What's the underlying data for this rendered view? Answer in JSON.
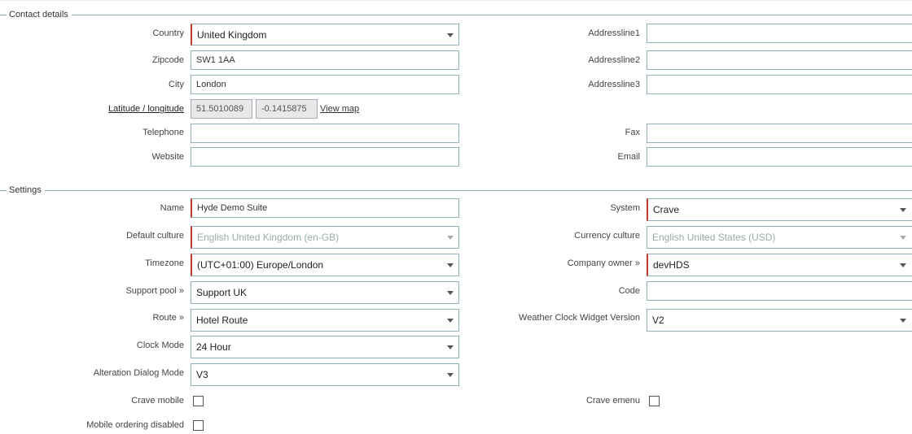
{
  "contact": {
    "legend": "Contact details",
    "country_label": "Country",
    "country_value": "United Kingdom",
    "zipcode_label": "Zipcode",
    "zipcode_value": "SW1 1AA",
    "city_label": "City",
    "city_value": "London",
    "latlng_label": "Latitude / longitude",
    "latitude": "51.5010089",
    "longitude": "-0.1415875",
    "view_map": "View map",
    "telephone_label": "Telephone",
    "telephone_value": "",
    "website_label": "Website",
    "website_value": "",
    "address1_label": "Addressline1",
    "address1_value": "",
    "address2_label": "Addressline2",
    "address2_value": "",
    "address3_label": "Addressline3",
    "address3_value": "",
    "fax_label": "Fax",
    "fax_value": "",
    "email_label": "Email",
    "email_value": ""
  },
  "settings": {
    "legend": "Settings",
    "name_label": "Name",
    "name_value": "Hyde Demo Suite",
    "culture_label": "Default culture",
    "culture_value": "English United Kingdom (en-GB)",
    "timezone_label": "Timezone",
    "timezone_value": "(UTC+01:00) Europe/London",
    "support_label": "Support pool »",
    "support_value": "Support UK",
    "route_label": "Route »",
    "route_value": "Hotel Route",
    "clock_label": "Clock Mode",
    "clock_value": "24 Hour",
    "alteration_label": "Alteration Dialog Mode",
    "alteration_value": "V3",
    "crave_mobile_label": "Crave mobile",
    "mobile_ordering_label": "Mobile ordering disabled",
    "system_label": "System",
    "system_value": "Crave",
    "currency_label": "Currency culture",
    "currency_value": "English United States (USD)",
    "company_label": "Company owner »",
    "company_value": "devHDS",
    "code_label": "Code",
    "code_value": "",
    "weather_label": "Weather Clock Widget Version",
    "weather_value": "V2",
    "crave_emenu_label": "Crave emenu"
  }
}
